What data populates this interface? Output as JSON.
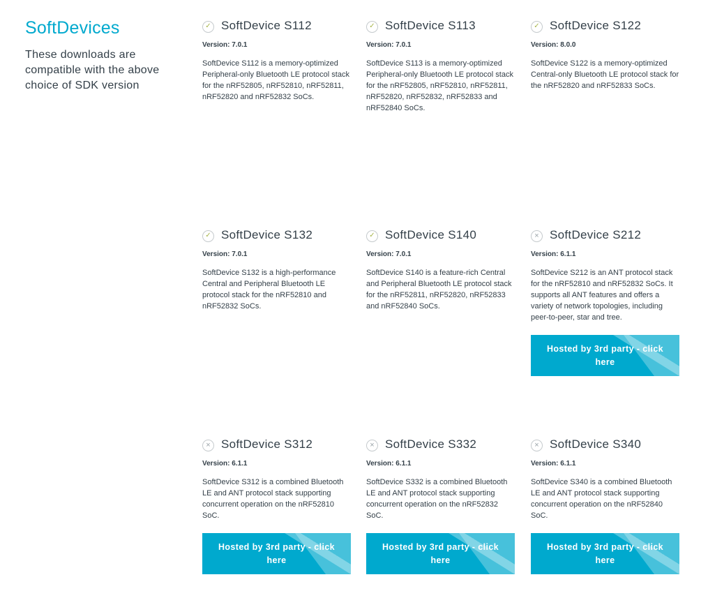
{
  "sidebar": {
    "title": "SoftDevices",
    "description": "These downloads are compatible with the above choice of SDK version"
  },
  "status_icons": {
    "compatible": "checkmark-icon",
    "incompatible": "cross-icon"
  },
  "colors": {
    "accent": "#00a9ce",
    "text": "#333f48",
    "check": "#a6b54a"
  },
  "cards": [
    {
      "status": "compatible",
      "status_glyph": "✓",
      "title": "SoftDevice S112",
      "version": "Version: 7.0.1",
      "description": "SoftDevice S112 is a memory-optimized Peripheral-only Bluetooth LE protocol stack for the nRF52805, nRF52810, nRF52811, nRF52820 and nRF52832 SoCs."
    },
    {
      "status": "compatible",
      "status_glyph": "✓",
      "title": "SoftDevice S113",
      "version": "Version: 7.0.1",
      "description": "SoftDevice S113 is a memory-optimized Peripheral-only Bluetooth LE protocol stack for the nRF52805, nRF52810, nRF52811, nRF52820, nRF52832, nRF52833 and nRF52840 SoCs."
    },
    {
      "status": "compatible",
      "status_glyph": "✓",
      "title": "SoftDevice S122",
      "version": "Version: 8.0.0",
      "description": "SoftDevice S122 is a memory-optimized Central-only Bluetooth LE protocol stack for the nRF52820 and nRF52833 SoCs."
    },
    {
      "status": "compatible",
      "status_glyph": "✓",
      "title": "SoftDevice S132",
      "version": "Version: 7.0.1",
      "description": "SoftDevice S132 is a high-performance Central and Peripheral Bluetooth LE protocol stack for the nRF52810 and nRF52832 SoCs."
    },
    {
      "status": "compatible",
      "status_glyph": "✓",
      "title": "SoftDevice S140",
      "version": "Version: 7.0.1",
      "description": "SoftDevice S140 is a feature-rich Central and Peripheral Bluetooth LE protocol stack for the nRF52811, nRF52820, nRF52833 and nRF52840 SoCs."
    },
    {
      "status": "incompatible",
      "status_glyph": "×",
      "title": "SoftDevice S212",
      "version": "Version: 6.1.1",
      "description": "SoftDevice S212 is an ANT protocol stack for the nRF52810 and nRF52832 SoCs. It supports all ANT features and offers a variety of network topologies, including peer-to-peer, star and tree.",
      "button": "Hosted by 3rd party - click here"
    },
    {
      "status": "incompatible",
      "status_glyph": "×",
      "title": "SoftDevice S312",
      "version": "Version: 6.1.1",
      "description": "SoftDevice S312 is a combined Bluetooth LE and ANT protocol stack supporting concurrent operation on the nRF52810 SoC.",
      "button": "Hosted by 3rd party - click here"
    },
    {
      "status": "incompatible",
      "status_glyph": "×",
      "title": "SoftDevice S332",
      "version": "Version: 6.1.1",
      "description": "SoftDevice S332 is a combined Bluetooth LE and ANT protocol stack supporting concurrent operation on the nRF52832 SoC.",
      "button": "Hosted by 3rd party - click here"
    },
    {
      "status": "incompatible",
      "status_glyph": "×",
      "title": "SoftDevice S340",
      "version": "Version: 6.1.1",
      "description": "SoftDevice S340 is a combined Bluetooth LE and ANT protocol stack supporting concurrent operation on the nRF52840 SoC.",
      "button": "Hosted by 3rd party - click here"
    }
  ]
}
